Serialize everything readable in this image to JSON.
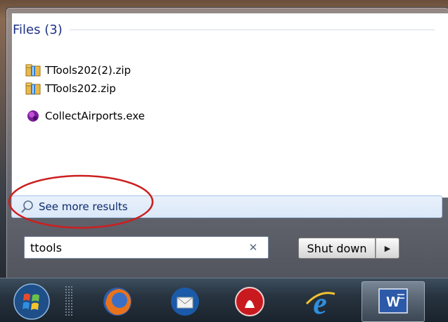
{
  "start_menu": {
    "group_title": "Files (3)",
    "files": [
      {
        "name": "TTools202(2).zip",
        "icon": "zip-folder-icon"
      },
      {
        "name": "TTools202.zip",
        "icon": "zip-folder-icon"
      },
      {
        "name": "CollectAirports.exe",
        "icon": "exe-app-icon"
      }
    ],
    "see_more_label": "See more results",
    "search": {
      "value": "ttools",
      "clear_glyph": "✕"
    },
    "shutdown": {
      "label": "Shut down",
      "arrow_glyph": "▶"
    }
  },
  "annotation": {
    "color": "#cc1f1f",
    "shape": "ellipse"
  },
  "taskbar": {
    "items": [
      "start-orb-icon",
      "firefox-icon",
      "thunderbird-icon",
      "app-red-icon",
      "internet-explorer-icon",
      "word-icon"
    ]
  }
}
